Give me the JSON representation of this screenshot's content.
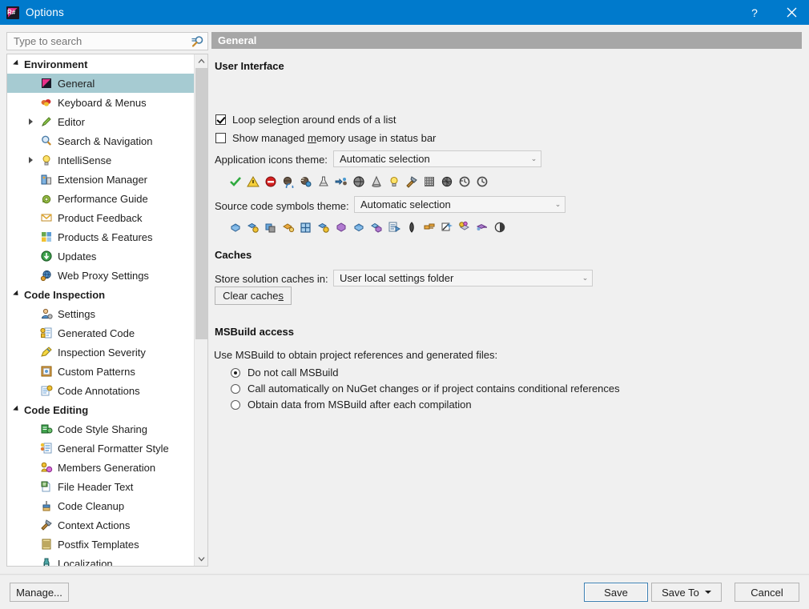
{
  "window": {
    "title": "Options",
    "icon": "resharper-logo-icon",
    "help_button": "?",
    "close_button": "✕"
  },
  "search": {
    "placeholder": "Type to search",
    "value": "",
    "icon": "search-icon"
  },
  "tree": [
    {
      "label": "Environment",
      "type": "group",
      "icon": "",
      "expanded": true,
      "selected": false
    },
    {
      "label": "General",
      "type": "leaf",
      "icon": "resharper-icon",
      "selected": true,
      "expandable": false
    },
    {
      "label": "Keyboard & Menus",
      "type": "leaf",
      "icon": "keyboard-menus-icon",
      "selected": false,
      "expandable": false
    },
    {
      "label": "Editor",
      "type": "leaf",
      "icon": "pencil-icon",
      "selected": false,
      "expandable": true
    },
    {
      "label": "Search & Navigation",
      "type": "leaf",
      "icon": "magnifier-icon",
      "selected": false,
      "expandable": false
    },
    {
      "label": "IntelliSense",
      "type": "leaf",
      "icon": "lightbulb-icon",
      "selected": false,
      "expandable": true
    },
    {
      "label": "Extension Manager",
      "type": "leaf",
      "icon": "extension-manager-icon",
      "selected": false,
      "expandable": false
    },
    {
      "label": "Performance Guide",
      "type": "leaf",
      "icon": "snail-icon",
      "selected": false,
      "expandable": false
    },
    {
      "label": "Product Feedback",
      "type": "leaf",
      "icon": "envelope-icon",
      "selected": false,
      "expandable": false
    },
    {
      "label": "Products & Features",
      "type": "leaf",
      "icon": "products-features-icon",
      "selected": false,
      "expandable": false
    },
    {
      "label": "Updates",
      "type": "leaf",
      "icon": "updates-icon",
      "selected": false,
      "expandable": false
    },
    {
      "label": "Web Proxy Settings",
      "type": "leaf",
      "icon": "globe-plug-icon",
      "selected": false,
      "expandable": false
    },
    {
      "label": "Code Inspection",
      "type": "group",
      "icon": "",
      "expanded": true,
      "selected": false
    },
    {
      "label": "Settings",
      "type": "leaf",
      "icon": "settings-person-icon",
      "selected": false,
      "expandable": false
    },
    {
      "label": "Generated Code",
      "type": "leaf",
      "icon": "generated-code-icon",
      "selected": false,
      "expandable": false
    },
    {
      "label": "Inspection Severity",
      "type": "leaf",
      "icon": "inspection-severity-icon",
      "selected": false,
      "expandable": false
    },
    {
      "label": "Custom Patterns",
      "type": "leaf",
      "icon": "custom-patterns-icon",
      "selected": false,
      "expandable": false
    },
    {
      "label": "Code Annotations",
      "type": "leaf",
      "icon": "code-annotations-icon",
      "selected": false,
      "expandable": false
    },
    {
      "label": "Code Editing",
      "type": "group",
      "icon": "",
      "expanded": true,
      "selected": false
    },
    {
      "label": "Code Style Sharing",
      "type": "leaf",
      "icon": "code-style-sharing-icon",
      "selected": false,
      "expandable": false
    },
    {
      "label": "General Formatter Style",
      "type": "leaf",
      "icon": "formatter-style-icon",
      "selected": false,
      "expandable": false
    },
    {
      "label": "Members Generation",
      "type": "leaf",
      "icon": "members-generation-icon",
      "selected": false,
      "expandable": false
    },
    {
      "label": "File Header Text",
      "type": "leaf",
      "icon": "file-header-icon",
      "selected": false,
      "expandable": false
    },
    {
      "label": "Code Cleanup",
      "type": "leaf",
      "icon": "broom-icon",
      "selected": false,
      "expandable": false
    },
    {
      "label": "Context Actions",
      "type": "leaf",
      "icon": "hammer-icon",
      "selected": false,
      "expandable": false
    },
    {
      "label": "Postfix Templates",
      "type": "leaf",
      "icon": "postfix-templates-icon",
      "selected": false,
      "expandable": false
    },
    {
      "label": "Localization",
      "type": "leaf",
      "icon": "localization-icon",
      "selected": false,
      "expandable": false
    }
  ],
  "page": {
    "header": "General",
    "sections": {
      "user_interface": {
        "title": "User Interface",
        "checkbox_loop": {
          "label": "Loop selection around ends of a list",
          "checked": true,
          "accel": "c"
        },
        "checkbox_memory": {
          "label": "Show managed memory usage in status bar",
          "checked": false,
          "accel": "m"
        },
        "app_icons_label": "Application icons theme:",
        "app_icons_value": "Automatic selection",
        "app_icons_strip": [
          "checkmark-green-icon",
          "warning-triangle-icon",
          "error-stop-icon",
          "globe-refresh-icon",
          "globe-search-icon",
          "flask-icon",
          "assembly-arrow-icon",
          "sphere-dark-icon",
          "cone-icon",
          "lightbulb-icon",
          "hammer-icon",
          "grid-dotted-icon",
          "globe-split-icon",
          "history-clock-icon",
          "clock-icon"
        ],
        "symbols_label": "Source code symbols theme:",
        "symbols_value": "Automatic selection",
        "symbols_strip": [
          "class-blue-icon",
          "class-private-icon",
          "copy-class-icon",
          "interface-key-icon",
          "layout-blue-icon",
          "method-private-icon",
          "struct-purple-icon",
          "struct-blue-icon",
          "enum-purple-icon",
          "file-list-icon",
          "namespace-dark-icon",
          "property-icon",
          "sparkle-icon",
          "type-gold-icon",
          "delegate-purple-icon",
          "contrast-icon"
        ]
      },
      "caches": {
        "title": "Caches",
        "store_label": "Store solution caches in:",
        "store_value": "User local settings folder",
        "clear_button": "Clear caches",
        "clear_button_accel": "s"
      },
      "msbuild": {
        "title": "MSBuild access",
        "description": "Use MSBuild to obtain project references and generated files:",
        "options": [
          {
            "label": "Do not call MSBuild",
            "selected": true
          },
          {
            "label": "Call automatically on NuGet changes or if project contains conditional references",
            "selected": false
          },
          {
            "label": "Obtain data from MSBuild after each compilation",
            "selected": false
          }
        ]
      }
    }
  },
  "footer": {
    "manage": "Manage...",
    "save": "Save",
    "save_to": "Save To",
    "cancel": "Cancel"
  },
  "colors": {
    "titlebar": "#007acc",
    "selection": "#a6cbd2",
    "page_header": "#a7a7a7",
    "dialog_bg": "#f0f0f0",
    "focus_border": "#3c7fb1"
  }
}
